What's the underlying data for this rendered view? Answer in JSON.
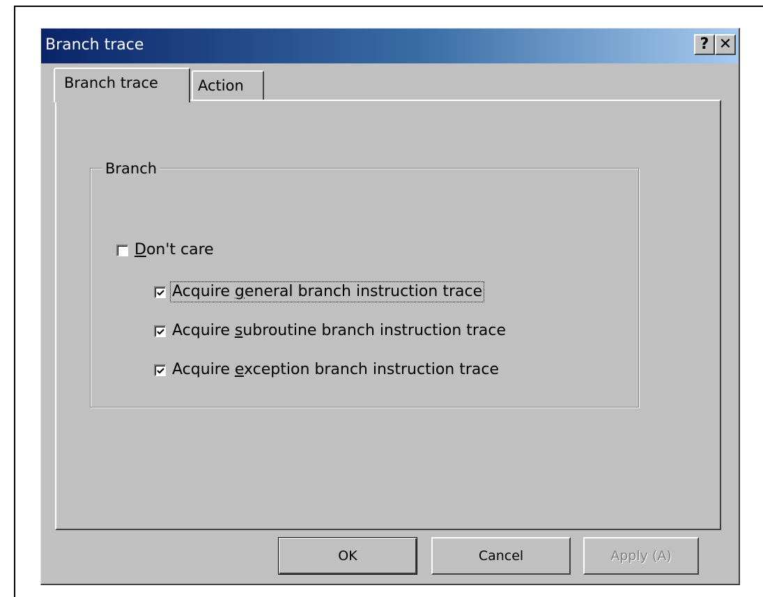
{
  "dialog": {
    "title": "Branch trace",
    "help_glyph": "?",
    "close_glyph": "✕"
  },
  "tabs": [
    {
      "label": "Branch trace",
      "selected": true
    },
    {
      "label": "Action",
      "selected": false
    }
  ],
  "group": {
    "label": "Branch"
  },
  "checkboxes": {
    "dont_care": {
      "pre": "",
      "mnemonic": "D",
      "post": "on't care",
      "checked": false
    },
    "general": {
      "pre": "Acquire ",
      "mnemonic": "g",
      "post": "eneral branch instruction trace",
      "checked": true,
      "focused": true
    },
    "subroutine": {
      "pre": "Acquire ",
      "mnemonic": "s",
      "post": "ubroutine branch instruction trace",
      "checked": true
    },
    "exception": {
      "pre": "Acquire ",
      "mnemonic": "e",
      "post": "xception branch instruction trace",
      "checked": true
    }
  },
  "buttons": {
    "ok": "OK",
    "cancel": "Cancel",
    "apply": "Apply (A)",
    "apply_enabled": false
  },
  "colors": {
    "title_start": "#0a246a",
    "title_end": "#a6caf0",
    "face": "#c0c0c0"
  },
  "icons": {
    "help": "help-icon",
    "close": "close-icon",
    "check": "checkmark-icon"
  }
}
